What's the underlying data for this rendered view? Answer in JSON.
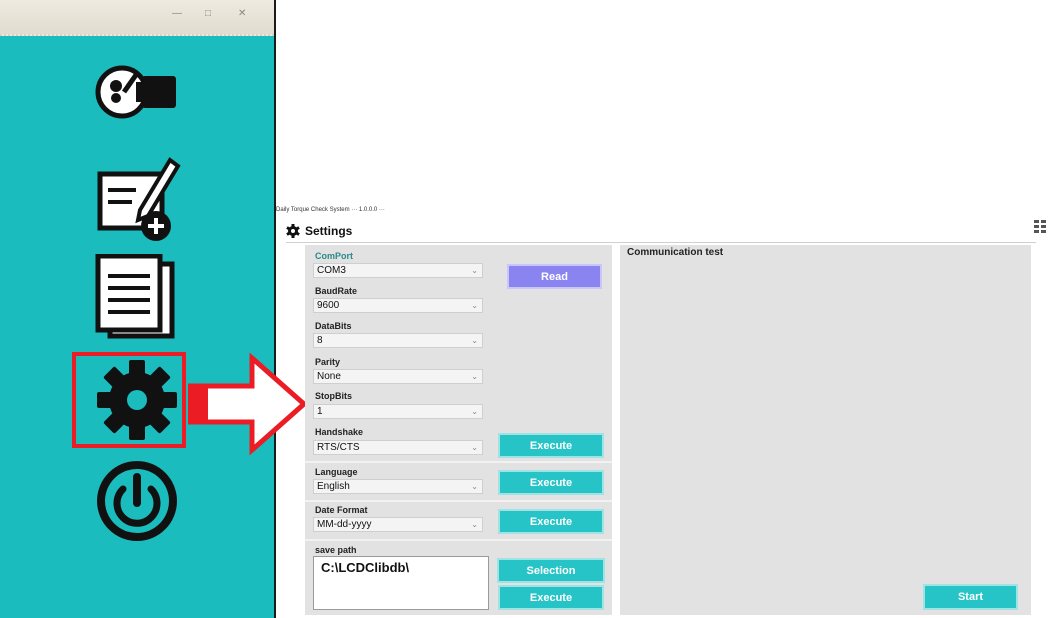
{
  "app": {
    "title": "Daily Torque Check System   ···  1.0.0.0  ···"
  },
  "sidebar": {
    "items": [
      {
        "icon": "torque-wrench-icon"
      },
      {
        "icon": "edit-add-icon"
      },
      {
        "icon": "document-list-icon"
      },
      {
        "icon": "settings-gear-icon"
      },
      {
        "icon": "power-icon"
      }
    ]
  },
  "tab": {
    "label": "Settings",
    "icon": "gear-icon"
  },
  "form": {
    "comport": {
      "label": "ComPort",
      "value": "COM3"
    },
    "baudrate": {
      "label": "BaudRate",
      "value": "9600"
    },
    "databits": {
      "label": "DataBits",
      "value": "8"
    },
    "parity": {
      "label": "Parity",
      "value": "None"
    },
    "stopbits": {
      "label": "StopBits",
      "value": "1"
    },
    "handshake": {
      "label": "Handshake",
      "value": "RTS/CTS"
    },
    "language": {
      "label": "Language",
      "value": "English"
    },
    "dateformat": {
      "label": "Date Format",
      "value": "MM-dd-yyyy"
    },
    "savepath": {
      "label": "save path",
      "value": "C:\\LCDClibdb\\"
    }
  },
  "buttons": {
    "read": "Read",
    "execute": "Execute",
    "selection": "Selection",
    "start": "Start"
  },
  "comm": {
    "title": "Communication test"
  },
  "colors": {
    "sidebar": "#1bbcbd",
    "accent": "#26c4c6",
    "read_button": "#8a84f0",
    "highlight": "#ec1c24"
  }
}
